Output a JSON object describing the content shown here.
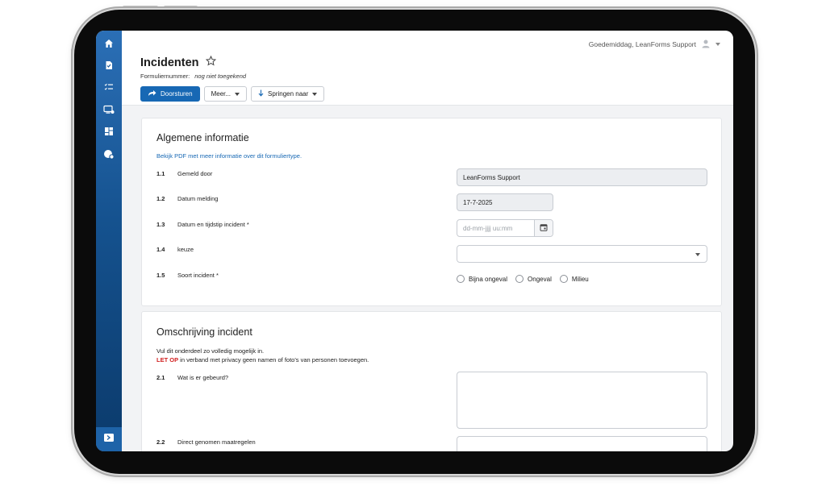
{
  "header": {
    "greeting": "Goedemiddag, LeanForms Support",
    "title": "Incidenten",
    "form_number_label": "Formuliernummer:",
    "form_number_value": "nog niet toegekend"
  },
  "toolbar": {
    "forward_label": "Doorsturen",
    "more_label": "Meer...",
    "jump_label": "Springen naar"
  },
  "sidebar": {
    "items": [
      "home-icon",
      "document-icon",
      "checklist-icon",
      "monitor-settings-icon",
      "dashboard-icon",
      "globe-settings-icon"
    ],
    "bottom": "expand-icon"
  },
  "section1": {
    "title": "Algemene informatie",
    "pdf_link": "Bekijk PDF met meer informatie over dit formuliertype.",
    "questions": [
      {
        "num": "1.1",
        "label": "Gemeld door",
        "value": "LeanForms Support"
      },
      {
        "num": "1.2",
        "label": "Datum melding",
        "value": "17-7-2025"
      },
      {
        "num": "1.3",
        "label": "Datum en tijdstip incident *",
        "placeholder": "dd-mm-jjjj uu:mm"
      },
      {
        "num": "1.4",
        "label": "keuze",
        "value": ""
      },
      {
        "num": "1.5",
        "label": "Soort incident *"
      }
    ],
    "radio_options": [
      "Bijna ongeval",
      "Ongeval",
      "Milieu"
    ]
  },
  "section2": {
    "title": "Omschrijving incident",
    "intro": "Vul dit onderdeel zo volledig mogelijk in.",
    "warning_prefix": "LET OP",
    "warning_text": " in verband met privacy geen namen of foto's van personen toevoegen.",
    "questions": [
      {
        "num": "2.1",
        "label": "Wat is er gebeurd?"
      },
      {
        "num": "2.2",
        "label": "Direct genomen maatregelen"
      }
    ]
  },
  "colors": {
    "accent": "#1768b4",
    "warning": "#d11f1f",
    "sidebar_top": "#2b6fb6",
    "sidebar_bottom": "#0b3a6b"
  }
}
